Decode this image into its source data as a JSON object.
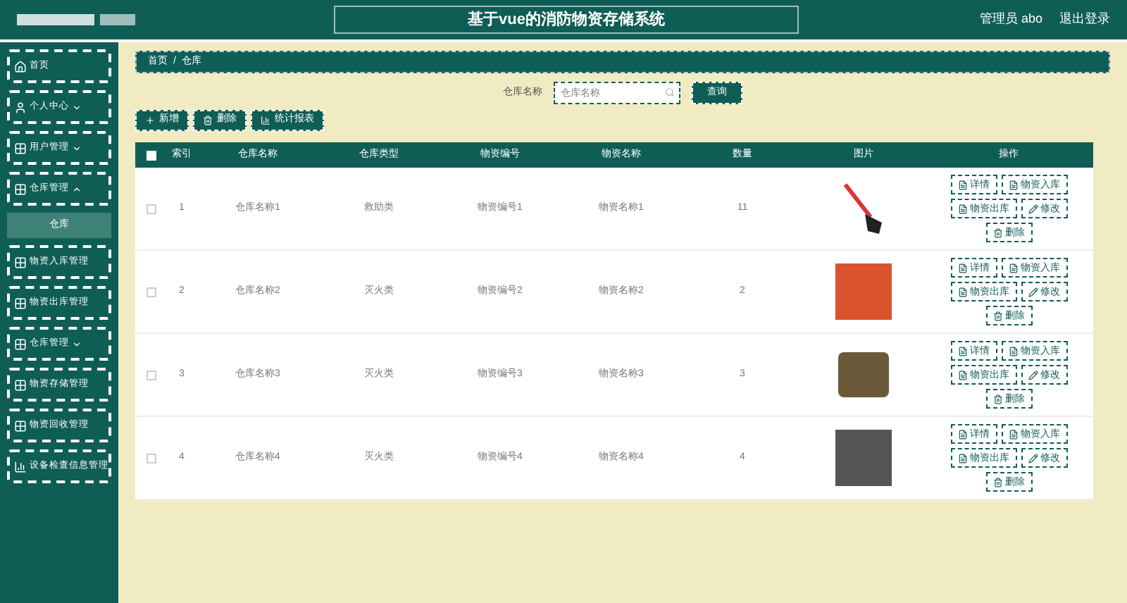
{
  "header": {
    "title": "基于vue的消防物资存储系统",
    "user": "管理员 abo",
    "logout": "退出登录"
  },
  "sidebar": {
    "items": [
      {
        "label": "首页",
        "kind": "link"
      },
      {
        "label": "个人中心",
        "kind": "menu",
        "expanded": false
      },
      {
        "label": "用户管理",
        "kind": "menu",
        "expanded": false
      },
      {
        "label": "仓库管理",
        "kind": "menu",
        "expanded": true,
        "children": [
          {
            "label": "仓库",
            "selected": true
          }
        ]
      },
      {
        "label": "物资入库管理",
        "kind": "link"
      },
      {
        "label": "物资出库管理",
        "kind": "link"
      },
      {
        "label": "仓库管理",
        "kind": "menu",
        "expanded": false
      },
      {
        "label": "物资存储管理",
        "kind": "link"
      },
      {
        "label": "物资回收管理",
        "kind": "link"
      },
      {
        "label": "设备检查信息管理",
        "kind": "link"
      }
    ]
  },
  "breadcrumb": {
    "items": [
      "首页",
      "仓库"
    ],
    "separator": "/"
  },
  "search": {
    "label": "仓库名称",
    "placeholder": "仓库名称",
    "button": "查询"
  },
  "toolbar": [
    "新增",
    "删除",
    "统计报表"
  ],
  "table": {
    "all_checked": false,
    "columns": [
      "索引",
      "仓库名称",
      "仓库类型",
      "物资编号",
      "物资名称",
      "数量",
      "图片",
      "操作"
    ],
    "rows": [
      {
        "checked": false,
        "cells": [
          "1",
          "仓库名称1",
          "救助类",
          "物资编号1",
          "物资名称1",
          "11"
        ],
        "actions": [
          "详情",
          "物资入库",
          "物资出库",
          "修改",
          "删除"
        ]
      },
      {
        "checked": false,
        "cells": [
          "2",
          "仓库名称2",
          "灭火类",
          "物资编号2",
          "物资名称2",
          "2"
        ],
        "actions": [
          "详情",
          "物资入库",
          "物资出库",
          "修改",
          "删除"
        ]
      },
      {
        "checked": false,
        "cells": [
          "3",
          "仓库名称3",
          "灭火类",
          "物资编号3",
          "物资名称3",
          "3"
        ],
        "actions": [
          "详情",
          "物资入库",
          "物资出库",
          "修改",
          "删除"
        ]
      },
      {
        "checked": false,
        "cells": [
          "4",
          "仓库名称4",
          "灭火类",
          "物资编号4",
          "物资名称4",
          "4"
        ],
        "actions": [
          "详情",
          "物资入库",
          "物资出库",
          "修改",
          "删除"
        ]
      }
    ]
  }
}
